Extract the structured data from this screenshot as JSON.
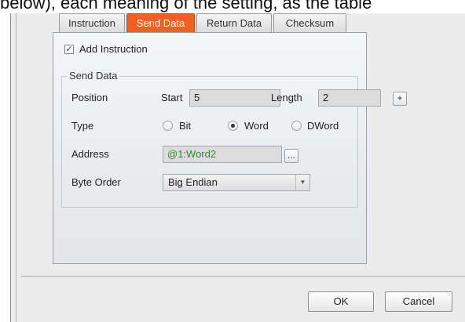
{
  "document": {
    "caption": "below), each meaning of the setting, as the table"
  },
  "tabs": [
    {
      "label": "Instruction",
      "active": false
    },
    {
      "label": "Send Data",
      "active": true
    },
    {
      "label": "Return Data",
      "active": false
    },
    {
      "label": "Checksum",
      "active": false
    }
  ],
  "add_instruction": {
    "label": "Add Instruction",
    "checked": true,
    "check_glyph": "✓"
  },
  "send_data_group": {
    "title": "Send Data",
    "position": {
      "label": "Position",
      "start_label": "Start",
      "start_value": "5",
      "length_label": "Length",
      "length_value": "2",
      "add_button": "+"
    },
    "type": {
      "label": "Type",
      "options": [
        "Bit",
        "Word",
        "DWord"
      ],
      "selected": "Word"
    },
    "address": {
      "label": "Address",
      "value": "@1:Word2",
      "browse_button": "...",
      "value_color": "#2e8b2e"
    },
    "byte_order": {
      "label": "Byte Order",
      "value": "Big Endian",
      "arrow_glyph": "▼"
    }
  },
  "buttons": {
    "ok": "OK",
    "cancel": "Cancel"
  },
  "colors": {
    "active_tab": "#f0601f"
  }
}
